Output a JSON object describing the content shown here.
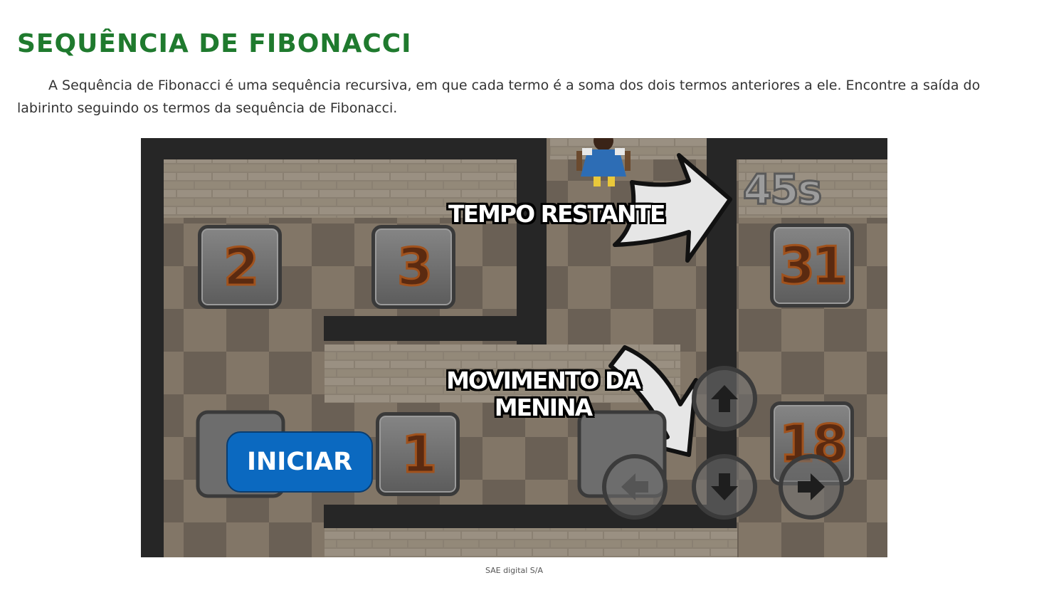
{
  "page": {
    "title": "SEQUÊNCIA DE FIBONACCI",
    "intro": "A Sequência de Fibonacci é uma sequência recursiva, em que cada termo é a soma dos dois termos anteriores a ele. Encontre a saída do labirinto seguindo os termos da sequência de Fibonacci.",
    "caption": "SAE digital S/A"
  },
  "game": {
    "timer": "45s",
    "tiles": [
      "2",
      "3",
      "31",
      "1",
      "18"
    ],
    "start_button": "INICIAR",
    "annotations": {
      "time": "TEMPO RESTANTE",
      "movement_line1": "MOVIMENTO DA",
      "movement_line2": "MENINA"
    },
    "controls": [
      "up-arrow-icon",
      "left-arrow-icon",
      "down-arrow-icon",
      "right-arrow-icon"
    ],
    "colors": {
      "title_green": "#1f7a2e",
      "start_blue": "#0b69c0",
      "tile_number": "#5b2a10"
    }
  }
}
